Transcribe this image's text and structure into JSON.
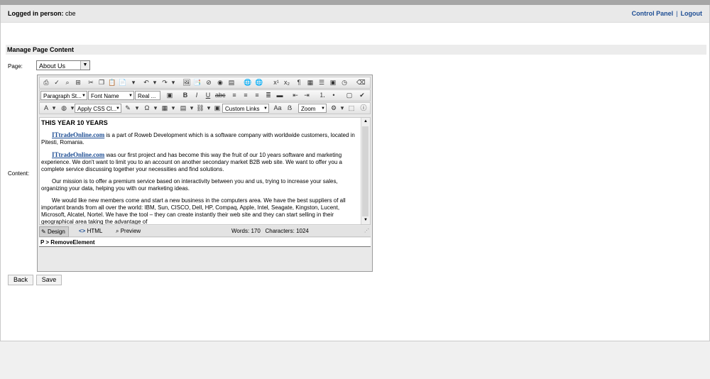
{
  "header": {
    "logged_label": "Logged in person:",
    "user": "cbe",
    "links": [
      "Control Panel",
      "Logout"
    ],
    "separator": "|"
  },
  "section_title": "Manage Page Content",
  "form": {
    "page_label": "Page:",
    "page_value": "About Us",
    "content_label": "Content:"
  },
  "editor": {
    "toolbar": {
      "paragraph_style": "Paragraph St...",
      "font_name": "Font Name",
      "font_size": "Real ...",
      "css_class": "Apply CSS Cl...",
      "custom_links": "Custom Links",
      "zoom": "Zoom"
    },
    "content": {
      "heading": "THIS YEAR 10 YEARS",
      "paragraphs": [
        {
          "link": "ITtradeOnline.com",
          "text": " is a part of Roweb Development which is a software company with worldwide customers, located in Pitesti, Romania."
        },
        {
          "link": "ITtradeOnline.com",
          "text": " was our first project and has become this way the fruit of our 10 years software and marketing experience. We don't want to limit you to an account on another secondary market B2B web site. We want to offer you a complete service discussing together your necessities and find solutions."
        },
        {
          "link": "",
          "text": "Our mission is to offer a premium service based on interactivity between you and us, trying to increase your sales, organizing your data, helping you with our marketing ideas."
        },
        {
          "link": "",
          "text": "We would like new members come and start a new business in the computers area. We have the best suppliers of all important brands from all over the world: IBM, Sun, CISCO, Dell, HP, Compaq, Apple, Intel, Seagate, Kingston, Lucent, Microsoft, Alcatel, Nortel. We have the tool – they can create instantly their web site and they can start selling in their geographical area taking the advantage of"
        }
      ]
    },
    "modes": [
      "Design",
      "HTML",
      "Preview"
    ],
    "active_mode": "Design",
    "stats": {
      "words_label": "Words:",
      "words": "170",
      "chars_label": "Characters:",
      "chars": "1024"
    },
    "path": "P > RemoveElement"
  },
  "buttons": {
    "back": "Back",
    "save": "Save"
  }
}
